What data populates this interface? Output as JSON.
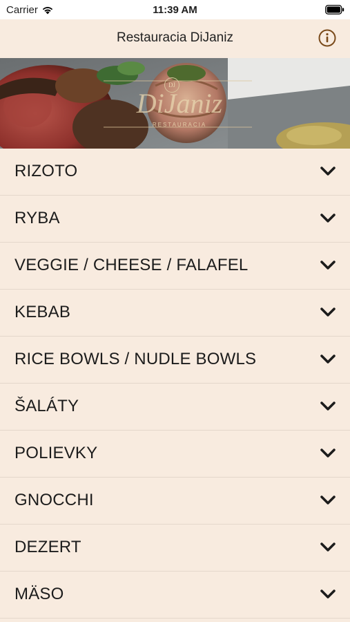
{
  "status_bar": {
    "carrier": "Carrier",
    "time": "11:39 AM"
  },
  "nav": {
    "title": "Restauracia DiJaniz",
    "info_icon": "info-circle-icon",
    "accent_color": "#7a4a1a"
  },
  "banner": {
    "logo_text": "DiJaniz",
    "logo_monogram": "DJ",
    "logo_subtitle": "RESTAURACIA"
  },
  "menu": {
    "items": [
      {
        "label": "RIZOTO"
      },
      {
        "label": "RYBA"
      },
      {
        "label": "VEGGIE / CHEESE / FALAFEL"
      },
      {
        "label": "KEBAB"
      },
      {
        "label": "RICE BOWLS / NUDLE BOWLS"
      },
      {
        "label": "ŠALÁTY"
      },
      {
        "label": "POLIEVKY"
      },
      {
        "label": "GNOCCHI"
      },
      {
        "label": "DEZERT"
      },
      {
        "label": "MÄSO"
      }
    ],
    "expand_icon": "chevron-down-icon"
  },
  "colors": {
    "background": "#f8ebdf",
    "divider": "#e4d7cb",
    "text": "#1c1c1c"
  }
}
